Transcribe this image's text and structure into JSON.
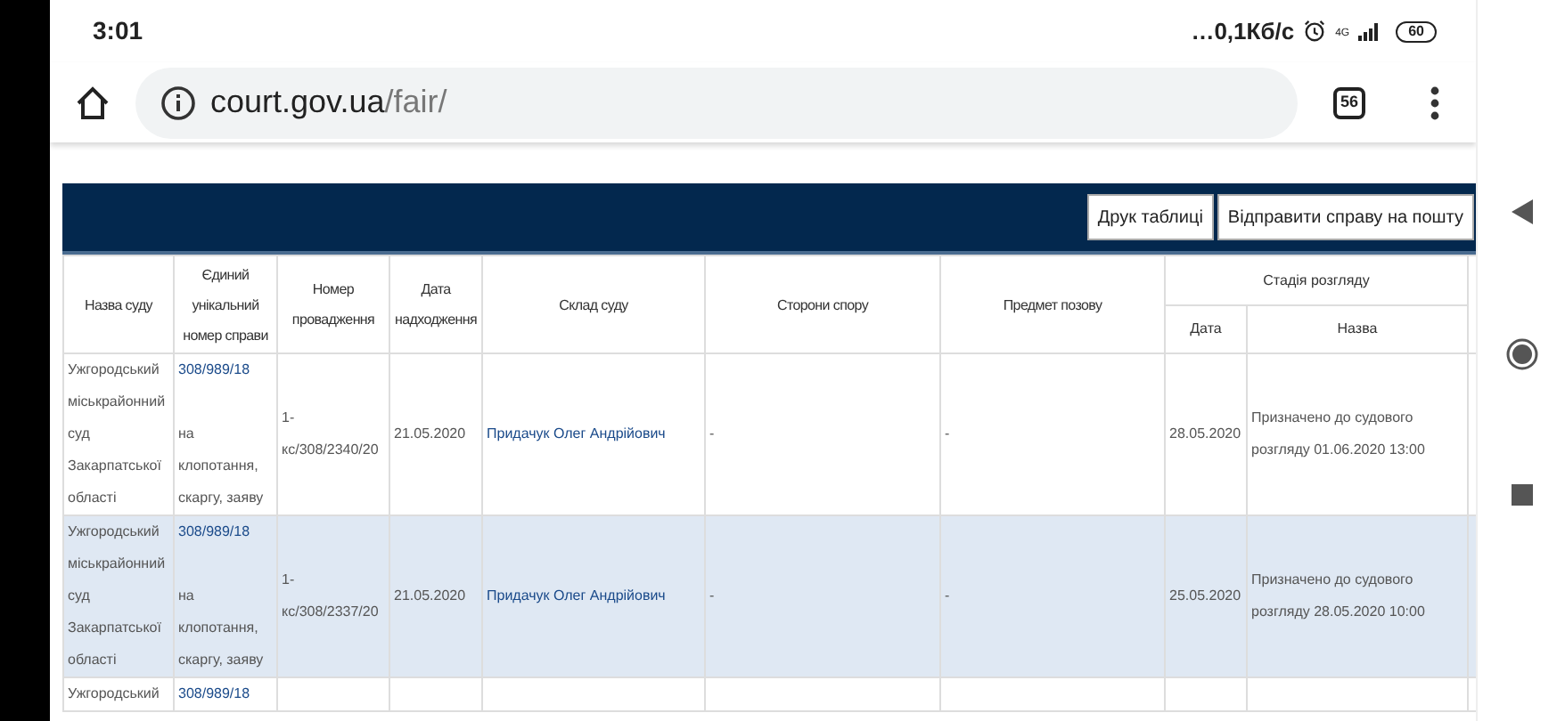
{
  "status_bar": {
    "time": "3:01",
    "network_speed": "…0,1Кб/с",
    "network_type": "4G",
    "battery": "60"
  },
  "browser": {
    "url_host": "court.gov.ua",
    "url_path": "/fair/",
    "tab_count": "56"
  },
  "toolbar": {
    "buttons": [
      "Друк таблиці",
      "Відправити справу на пошту"
    ]
  },
  "table": {
    "columns": [
      {
        "label": "Назва суду"
      },
      {
        "label": "Єдиний унікальний номер справи"
      },
      {
        "label": "Номер провадження"
      },
      {
        "label": "Дата надходження"
      },
      {
        "label": "Склад суду"
      },
      {
        "label": "Сторони спору"
      },
      {
        "label": "Предмет позову"
      },
      {
        "label": "Стадія розгляду",
        "children": [
          {
            "label": "Дата"
          },
          {
            "label": "Назва"
          }
        ]
      }
    ],
    "rows": [
      {
        "selected": false,
        "court": "Ужгородський міськрайонний суд Закарпатської області",
        "case_number": "308/989/18",
        "case_category": "на клопотання, скаргу, заяву",
        "proceeding": "1-кс/308/2340/20",
        "received": "21.05.2020",
        "judges": "Придачук Олег Андрійович",
        "parties": "-",
        "subject": "-",
        "stage_date": "28.05.2020",
        "stage_name": "Призначено до судового розгляду 01.06.2020 13:00"
      },
      {
        "selected": true,
        "court": "Ужгородський міськрайонний суд Закарпатської області",
        "case_number": "308/989/18",
        "case_category": "на клопотання, скаргу, заяву",
        "proceeding": "1-кс/308/2337/20",
        "received": "21.05.2020",
        "judges": "Придачук Олег Андрійович",
        "parties": "-",
        "subject": "-",
        "stage_date": "25.05.2020",
        "stage_name": "Призначено до судового розгляду 28.05.2020 10:00"
      },
      {
        "selected": false,
        "court": "Ужгородський",
        "case_number": "308/989/18"
      }
    ]
  }
}
